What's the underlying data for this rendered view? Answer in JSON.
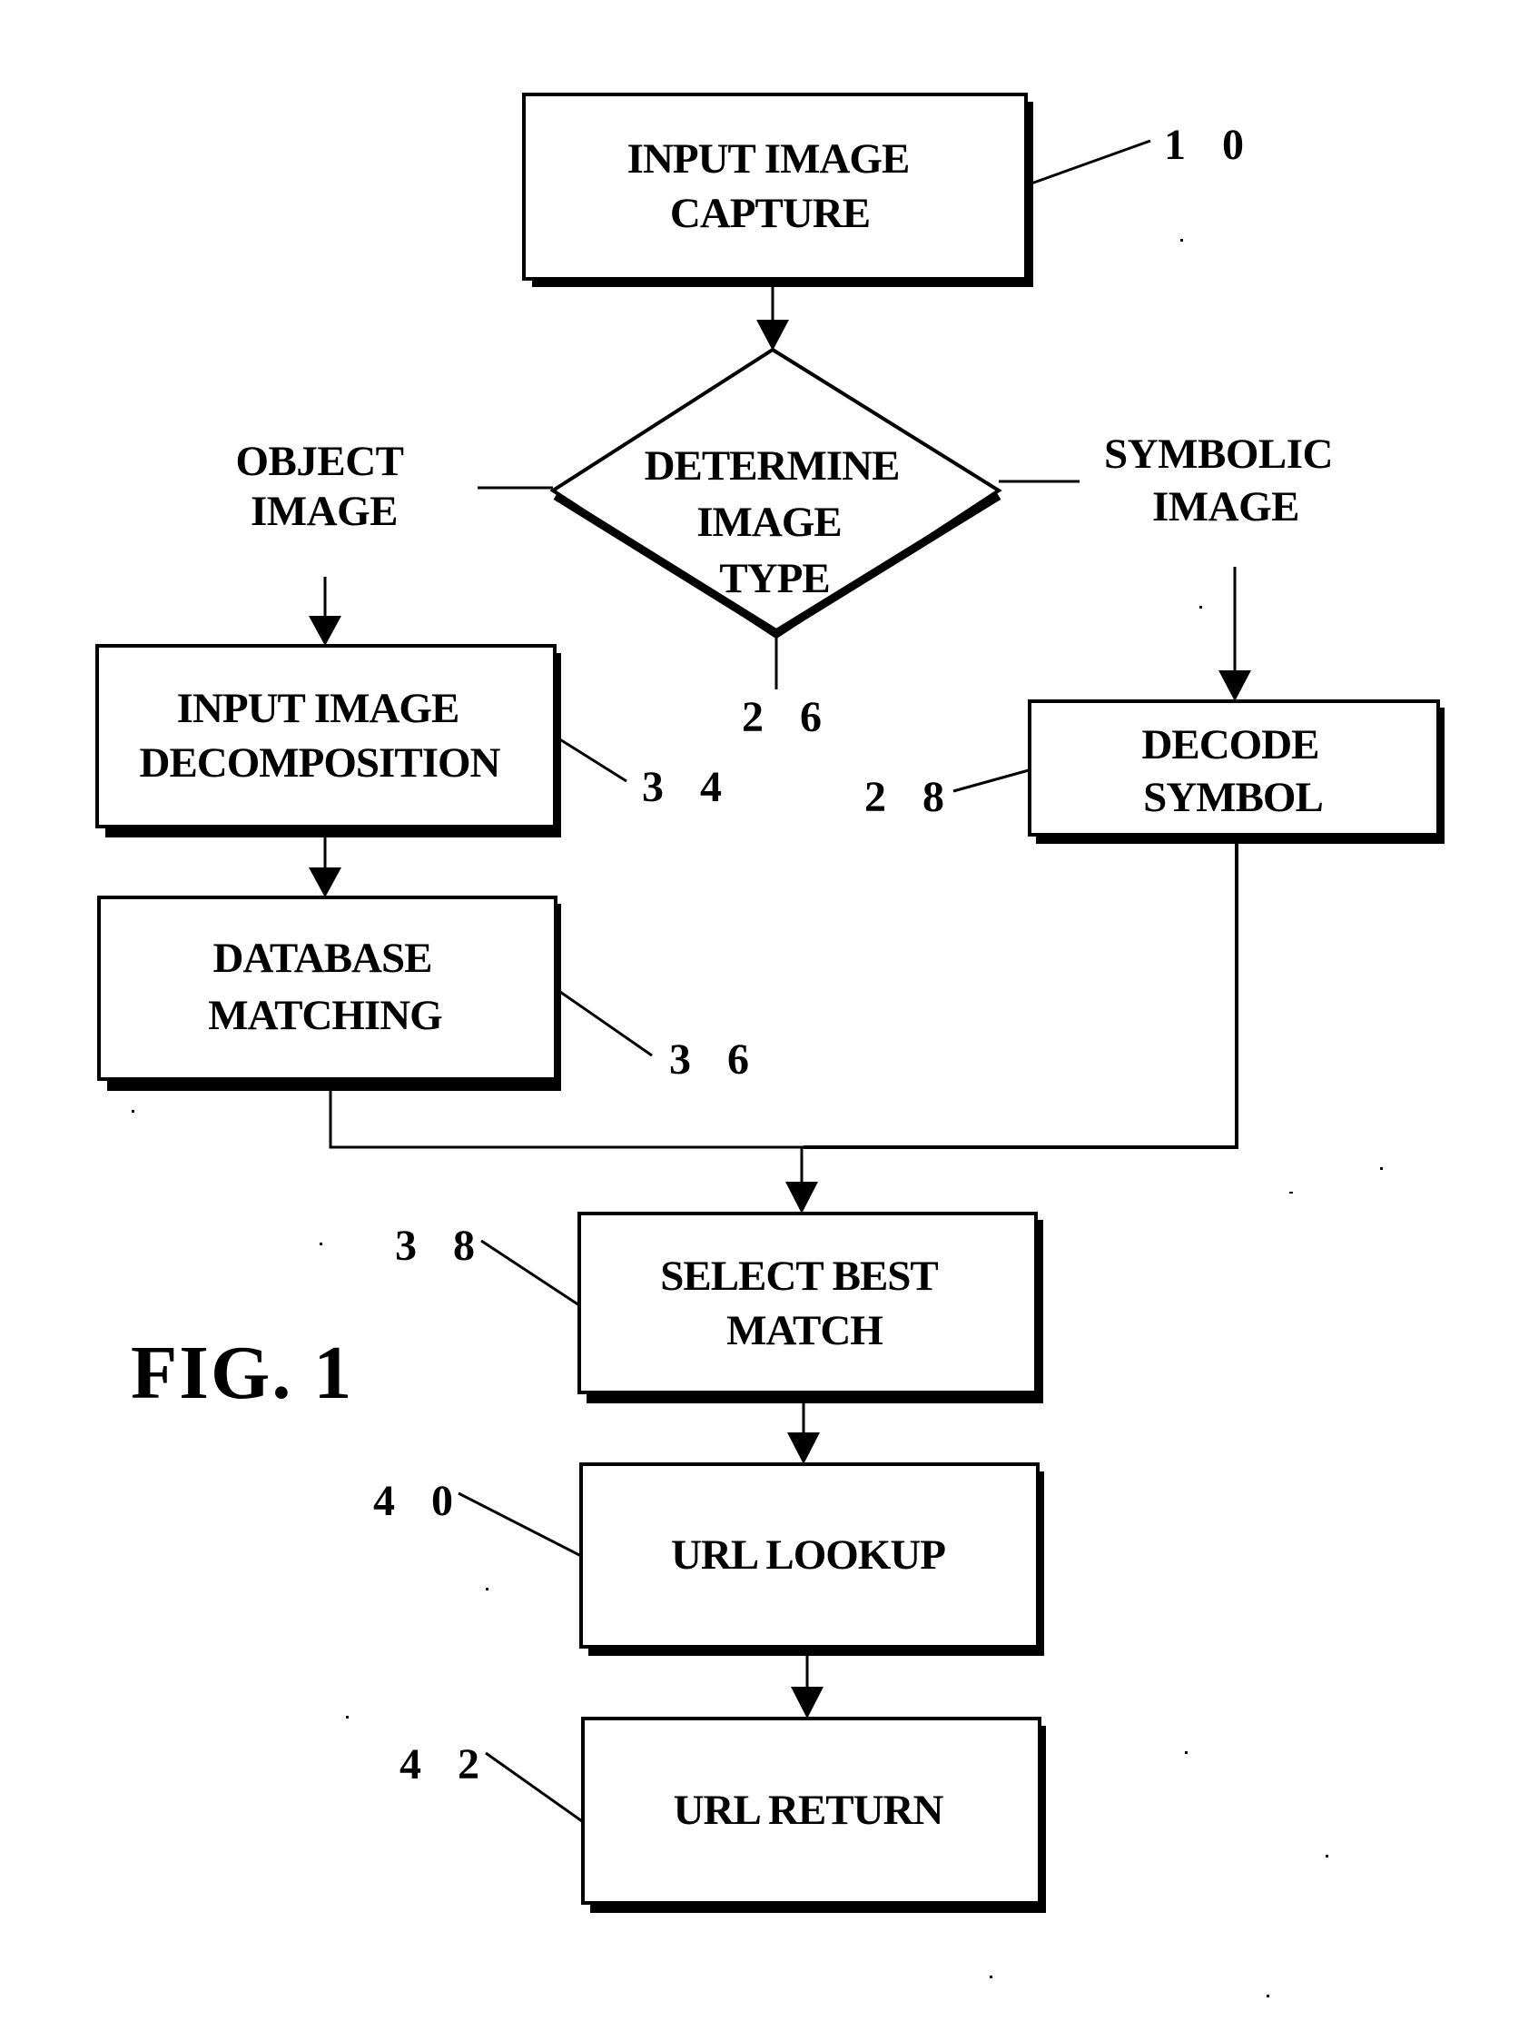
{
  "figure": {
    "title": "FIG. 1",
    "colors": {
      "ink": "#000000",
      "paper": "#ffffff"
    }
  },
  "nodes": {
    "input_capture": {
      "ref": "10",
      "lines": [
        "INPUT IMAGE",
        "CAPTURE"
      ],
      "shape": "process"
    },
    "determine_type": {
      "ref": "26",
      "lines": [
        "DETERMINE",
        "IMAGE",
        "TYPE"
      ],
      "shape": "decision"
    },
    "decode_symbol": {
      "ref": "28",
      "lines": [
        "DECODE",
        "SYMBOL"
      ],
      "shape": "process"
    },
    "decomposition": {
      "ref": "34",
      "lines": [
        "INPUT IMAGE",
        "DECOMPOSITION"
      ],
      "shape": "process"
    },
    "db_matching": {
      "ref": "36",
      "lines": [
        "DATABASE",
        "MATCHING"
      ],
      "shape": "process"
    },
    "select_best": {
      "ref": "38",
      "lines": [
        "SELECT BEST",
        "MATCH"
      ],
      "shape": "process"
    },
    "url_lookup": {
      "ref": "40",
      "lines": [
        "URL LOOKUP"
      ],
      "shape": "process"
    },
    "url_return": {
      "ref": "42",
      "lines": [
        "URL RETURN"
      ],
      "shape": "process"
    }
  },
  "branches": {
    "left": {
      "lines": [
        "OBJECT",
        "IMAGE"
      ]
    },
    "right": {
      "lines": [
        "SYMBOLIC",
        "IMAGE"
      ]
    }
  },
  "ref_labels": {
    "r10": "1 0",
    "r26": "2 6",
    "r28": "2 8",
    "r34": "3 4",
    "r36": "3 6",
    "r38": "3 8",
    "r40": "4 0",
    "r42": "4 2"
  },
  "edges": [
    {
      "from": "input_capture",
      "to": "determine_type"
    },
    {
      "from": "determine_type",
      "to": "decomposition",
      "label": "OBJECT IMAGE"
    },
    {
      "from": "determine_type",
      "to": "decode_symbol",
      "label": "SYMBOLIC IMAGE"
    },
    {
      "from": "decomposition",
      "to": "db_matching"
    },
    {
      "from": "db_matching",
      "to": "select_best"
    },
    {
      "from": "decode_symbol",
      "to": "select_best"
    },
    {
      "from": "select_best",
      "to": "url_lookup"
    },
    {
      "from": "url_lookup",
      "to": "url_return"
    }
  ]
}
